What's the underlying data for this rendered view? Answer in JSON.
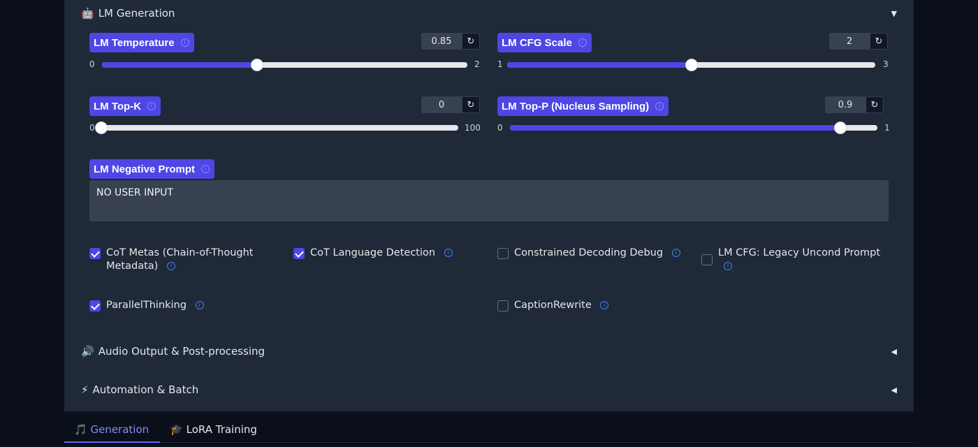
{
  "lm_generation": {
    "icon": "robot-icon",
    "emoji": "🤖",
    "title": "LM Generation",
    "arrow": "▼"
  },
  "sliders": [
    {
      "label": "LM Temperature",
      "value": "0.85",
      "min": "0",
      "max": "2",
      "fraction": 0.425
    },
    {
      "label": "LM CFG Scale",
      "value": "2",
      "min": "1",
      "max": "3",
      "fraction": 0.5
    },
    {
      "label": "LM Top-K",
      "value": "0",
      "min": "0",
      "max": "100",
      "fraction": 0.0
    },
    {
      "label": "LM Top-P (Nucleus Sampling)",
      "value": "0.9",
      "min": "0",
      "max": "1",
      "fraction": 0.9
    }
  ],
  "reset_glyph": "↻",
  "info_glyph": "i",
  "negative_prompt": {
    "label": "LM Negative Prompt",
    "value": "NO USER INPUT"
  },
  "checkboxes": [
    {
      "label": "CoT Metas (Chain-of-Thought Metadata)",
      "checked": true
    },
    {
      "label": "CoT Language Detection",
      "checked": true
    },
    {
      "label": "Constrained Decoding Debug",
      "checked": false
    },
    {
      "label": "LM CFG: Legacy Uncond Prompt",
      "checked": false
    },
    {
      "label": "ParallelThinking",
      "checked": true
    },
    {
      "label": "CaptionRewrite",
      "checked": false
    }
  ],
  "audio_output": {
    "icon": "speaker-icon",
    "emoji": "🔊",
    "title": "Audio Output & Post-processing",
    "arrow": "◀"
  },
  "automation": {
    "icon": "lightning-icon",
    "emoji": "⚡",
    "title": "Automation & Batch",
    "arrow": "◀"
  },
  "tabs": [
    {
      "icon": "music-note-icon",
      "emoji": "🎵",
      "label": "Generation",
      "active": true
    },
    {
      "icon": "graduation-cap-icon",
      "emoji": "🎓",
      "label": "LoRA Training",
      "active": false
    }
  ],
  "colors": {
    "accent": "#4f46e5",
    "panel": "#1f2937",
    "background": "#0b0f19"
  }
}
